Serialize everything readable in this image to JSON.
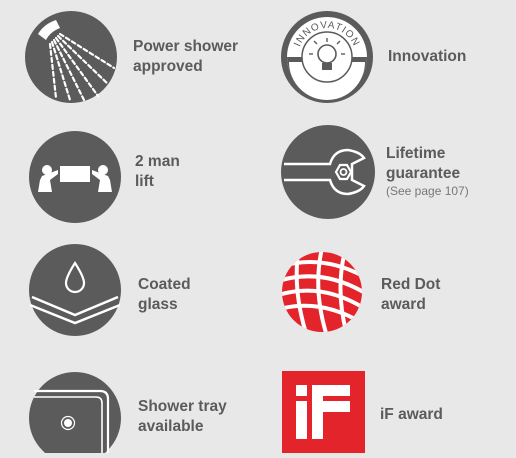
{
  "items": [
    {
      "id": "power-shower",
      "lines": [
        "Power shower",
        "approved"
      ],
      "icon": "shower-head-icon"
    },
    {
      "id": "innovation",
      "lines": [
        "Innovation"
      ],
      "icon": "innovation-lightbulb-icon",
      "badge_text": "INNOVATION"
    },
    {
      "id": "two-man-lift",
      "lines": [
        "2 man",
        "lift"
      ],
      "icon": "two-man-lift-icon"
    },
    {
      "id": "lifetime-guarantee",
      "lines": [
        "Lifetime",
        "guarantee"
      ],
      "note": "(See page 107)",
      "icon": "wrench-icon"
    },
    {
      "id": "coated-glass",
      "lines": [
        "Coated",
        "glass"
      ],
      "icon": "coated-glass-icon"
    },
    {
      "id": "red-dot",
      "lines": [
        "Red Dot",
        "award"
      ],
      "icon": "red-dot-award-icon"
    },
    {
      "id": "shower-tray",
      "lines": [
        "Shower tray",
        "available"
      ],
      "icon": "shower-tray-icon"
    },
    {
      "id": "if-award",
      "lines": [
        "iF award"
      ],
      "icon": "if-award-logo-icon"
    }
  ],
  "colors": {
    "background": "#e8e8e8",
    "icon_dark": "#5b5b5b",
    "text": "#5b5b5b",
    "red": "#e3242b"
  }
}
